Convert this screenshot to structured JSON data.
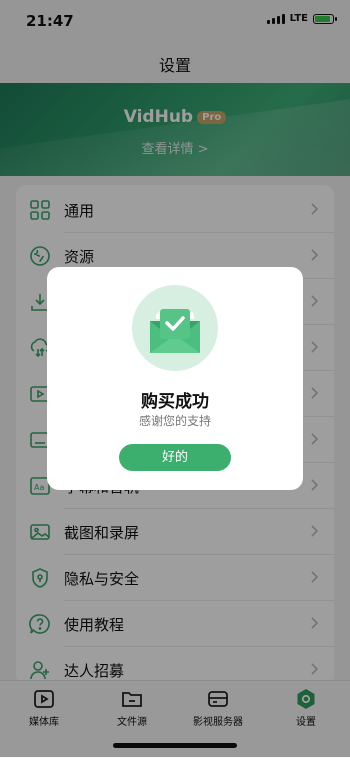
{
  "status_bar": {
    "time": "21:47",
    "network": "LTE"
  },
  "page_title": "设置",
  "banner": {
    "brand": "VidHub",
    "badge": "Pro",
    "details_link": "查看详情 >"
  },
  "settings": [
    {
      "label": "通用",
      "icon": "grid-icon"
    },
    {
      "label": "资源",
      "icon": "resource-icon"
    },
    {
      "label": "",
      "icon": "download-icon"
    },
    {
      "label": "",
      "icon": "sync-icon"
    },
    {
      "label": "",
      "icon": "play-icon"
    },
    {
      "label": "",
      "icon": "subtitle-icon"
    },
    {
      "label": "字幕和音轨",
      "icon": "audio-track-icon"
    },
    {
      "label": "截图和录屏",
      "icon": "image-icon"
    },
    {
      "label": "隐私与安全",
      "icon": "shield-icon"
    },
    {
      "label": "使用教程",
      "icon": "help-icon"
    },
    {
      "label": "达人招募",
      "icon": "person-icon"
    }
  ],
  "tabs": [
    {
      "label": "媒体库",
      "icon": "play-box-icon",
      "active": false
    },
    {
      "label": "文件源",
      "icon": "folder-icon",
      "active": false
    },
    {
      "label": "影视服务器",
      "icon": "server-icon",
      "active": false
    },
    {
      "label": "设置",
      "icon": "settings-icon",
      "active": true
    }
  ],
  "dialog": {
    "title": "购买成功",
    "subtitle": "感谢您的支持",
    "button": "好的"
  },
  "colors": {
    "accent": "#3cae6e",
    "banner": "#2e9a6a",
    "badge": "#c8a46a"
  }
}
